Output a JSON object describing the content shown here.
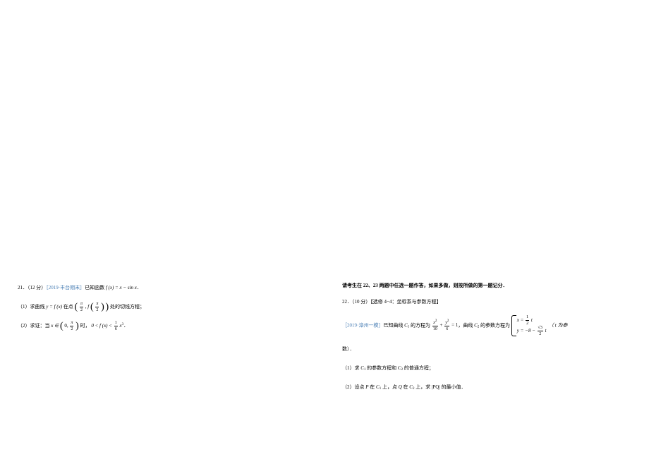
{
  "left": {
    "problem21": {
      "number": "21．（12 分）",
      "source": "［2019·丰台期末］",
      "intro": "已知函数",
      "func_def": "f (x) = x − sin x",
      "period": "．",
      "part1_label": "（1）求曲线",
      "part1_curve": "y = f (x)",
      "part1_at": "在点",
      "part1_point_open": "(",
      "part1_point_x": "π",
      "part1_point_x_den": "2",
      "part1_point_sep": ", ",
      "part1_point_f": "f",
      "part1_point_close": ")",
      "part1_end": "处的切线方程；",
      "part2_label": "（2）求证：当",
      "part2_domain_var": "x ∈",
      "part2_interval_open": "(",
      "part2_interval_a": "0, ",
      "part2_interval_b_num": "π",
      "part2_interval_b_den": "2",
      "part2_interval_close": ")",
      "part2_when": "时，",
      "part2_ineq_left": "0 < f (x) < ",
      "part2_ineq_frac_num": "1",
      "part2_ineq_frac_den": "6",
      "part2_ineq_right": "x",
      "part2_ineq_pow": "3",
      "part2_period": "．"
    }
  },
  "right": {
    "instruction": "请考生在 22、23 两题中任选一题作答，如果多做，则按所做的第一题记分．",
    "problem22": {
      "number": "22．（10 分）",
      "topic": "【选修 4−4：坐标系与参数方程】",
      "source": "［2019·漳州一模］",
      "intro_a": "已知曲线",
      "c1": "C",
      "c1_sub": "1",
      "intro_b": "的方程为",
      "eq_frac1_num": "x",
      "eq_frac1_pow": "2",
      "eq_frac1_den": "10",
      "eq_plus": " + ",
      "eq_frac2_num": "y",
      "eq_frac2_pow": "2",
      "eq_frac2_den": "6",
      "eq_equals": " = 1",
      "intro_c": "，曲线",
      "c2": "C",
      "c2_sub": "2",
      "intro_d": "的参数方程为",
      "brace_line1_x": "x = ",
      "brace_line1_frac_num": "1",
      "brace_line1_frac_den": "2",
      "brace_line1_t": "t",
      "brace_line2_y": "y = −8 − ",
      "brace_line2_sqrt": "√3",
      "brace_line2_frac_den": "2",
      "brace_line2_t": "t",
      "param_note": "（ t 为参",
      "param_note_2": "数）．",
      "part1": "（1）求",
      "part1_c1": "C",
      "part1_c1_sub": "1",
      "part1_mid": "的参数方程和",
      "part1_c2": "C",
      "part1_c2_sub": "2",
      "part1_end": "的普通方程；",
      "part2": "（2）设点",
      "part2_p": "P",
      "part2_on1": " 在 ",
      "part2_c1": "C",
      "part2_c1_sub": "1",
      "part2_up": " 上，点 ",
      "part2_q": "Q",
      "part2_on2": " 在 ",
      "part2_c2": "C",
      "part2_c2_sub": "2",
      "part2_up2": " 上，求",
      "part2_pq": "|PQ|",
      "part2_end": "的最小值．"
    }
  }
}
